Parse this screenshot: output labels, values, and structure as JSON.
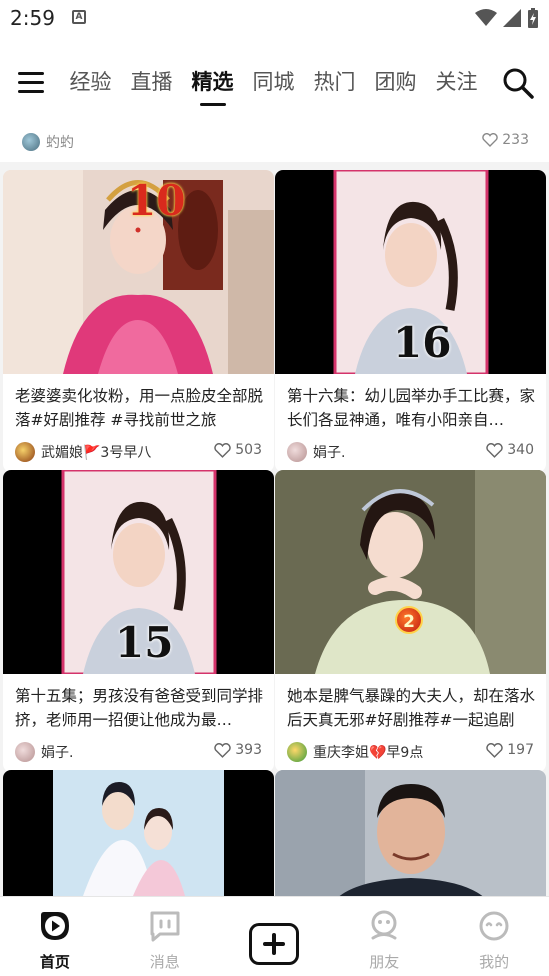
{
  "status_bar": {
    "time": "2:59",
    "notification_letter": "A"
  },
  "top_nav": {
    "tabs": [
      "经验",
      "直播",
      "精选",
      "同城",
      "热门",
      "团购",
      "关注"
    ],
    "active_tab": "精选"
  },
  "feed": {
    "partial_item": {
      "author": "虳虳",
      "likes": "233"
    },
    "cards": [
      {
        "title": "老婆婆卖化妆粉，用一点脸皮全部脱落#好剧推荐 #寻找前世之旅",
        "author": "武媚娘🚩3号早八",
        "likes": "503",
        "badge": "10"
      },
      {
        "title": "第十六集：幼儿园举办手工比赛，家长们各显神通，唯有小阳亲自…",
        "author": "娟子.",
        "likes": "340",
        "badge": "16"
      },
      {
        "title": "第十五集；男孩没有爸爸受到同学排挤，老师用一招便让他成为最…",
        "author": "娟子.",
        "likes": "393",
        "badge": "15"
      },
      {
        "title": "她本是脾气暴躁的大夫人，却在落水后天真无邪#好剧推荐#一起追剧",
        "author": "重庆李姐💔早9点",
        "likes": "197",
        "badge": "2"
      },
      {
        "title": "",
        "author": "",
        "likes": "",
        "badge": ""
      },
      {
        "title": "",
        "author": "",
        "likes": "",
        "badge": ""
      }
    ]
  },
  "bottom_nav": {
    "items": [
      "首页",
      "消息",
      "",
      "朋友",
      "我的"
    ],
    "active": "首页"
  },
  "colors": {
    "accent": "#111111",
    "like_icon": "#666666",
    "badge_red": "#d92a1d"
  }
}
